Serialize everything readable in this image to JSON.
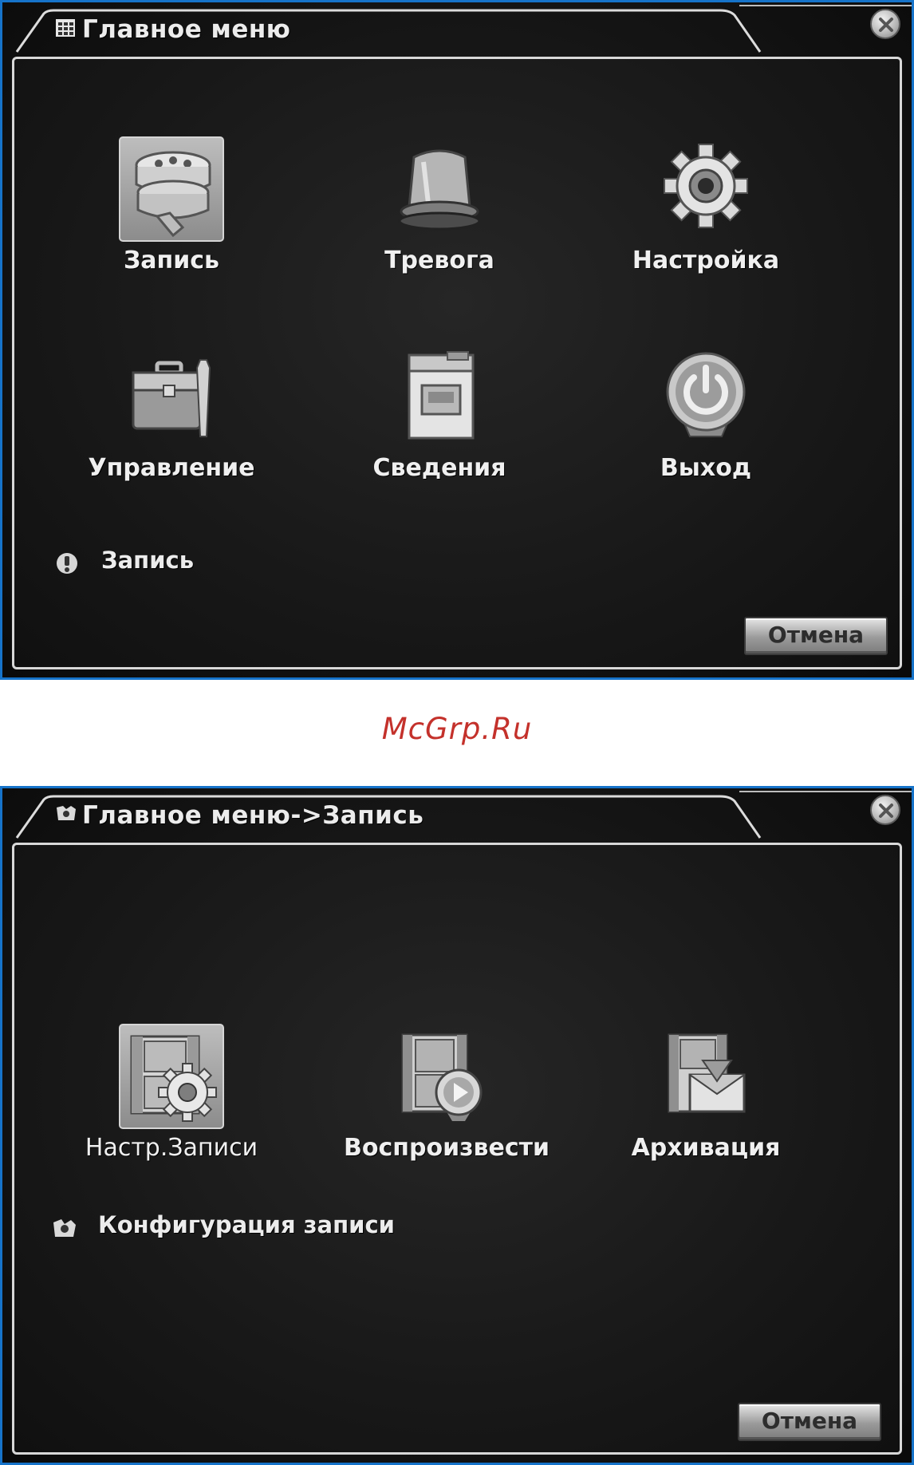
{
  "main_menu": {
    "title": "Главное меню",
    "items": [
      {
        "label": "Запись",
        "icon": "film-reels-icon",
        "selected": true
      },
      {
        "label": "Тревога",
        "icon": "alarm-siren-icon",
        "selected": false
      },
      {
        "label": "Настройка",
        "icon": "gear-icon",
        "selected": false
      },
      {
        "label": "Управление",
        "icon": "toolbox-icon",
        "selected": false
      },
      {
        "label": "Сведения",
        "icon": "info-folder-icon",
        "selected": false
      },
      {
        "label": "Выход",
        "icon": "power-icon",
        "selected": false
      }
    ],
    "status_text": "Запись",
    "status_icon": "exclamation-icon",
    "cancel_label": "Отмена",
    "close_icon": "close-icon"
  },
  "watermark": "McGrp.Ru",
  "record_menu": {
    "title": "Главное меню->Запись",
    "items": [
      {
        "label": "Настр.Записи",
        "icon": "film-gear-icon",
        "selected": true
      },
      {
        "label": "Воспроизвести",
        "icon": "film-play-icon",
        "selected": false
      },
      {
        "label": "Архивация",
        "icon": "film-archive-icon",
        "selected": false
      }
    ],
    "status_text": "Конфигурация  записи",
    "status_icon": "record-config-icon",
    "cancel_label": "Отмена",
    "close_icon": "close-icon"
  },
  "colors": {
    "frame_border": "#1673c9",
    "background": "#141414",
    "text": "#f0f0f0",
    "watermark": "#c4312b"
  }
}
